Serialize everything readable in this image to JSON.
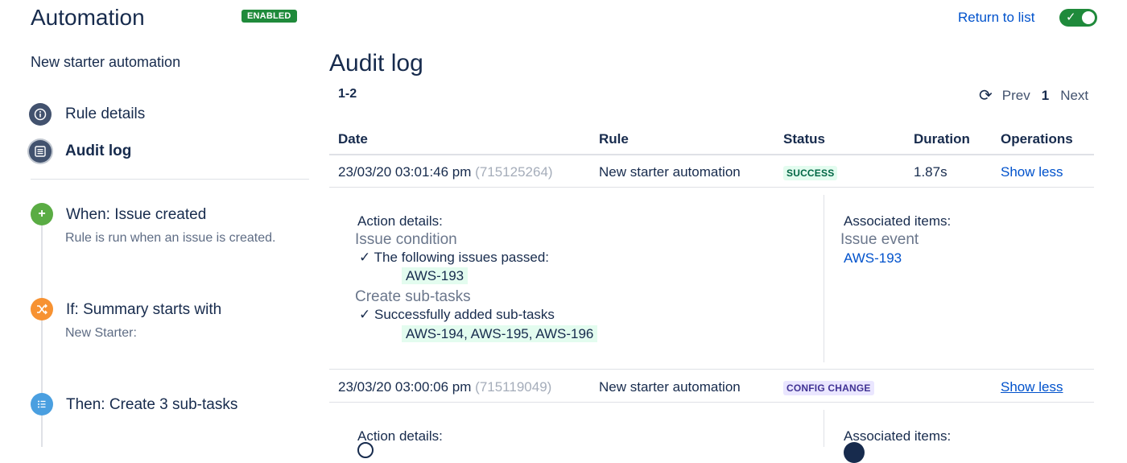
{
  "header": {
    "app_title": "Automation",
    "status_badge": "ENABLED",
    "return_link": "Return to list",
    "toggle_state": "on"
  },
  "sidebar": {
    "rule_name": "New starter automation",
    "nav": [
      {
        "label": "Rule details",
        "icon": "info-icon",
        "active": false
      },
      {
        "label": "Audit log",
        "icon": "list-icon",
        "active": true
      }
    ],
    "steps": [
      {
        "title": "When: Issue created",
        "desc": "Rule is run when an issue is created.",
        "icon": "plus-icon",
        "color": "#5aac44"
      },
      {
        "title": "If: Summary starts with",
        "desc": "New Starter:",
        "icon": "shuffle-icon",
        "color": "#f79232"
      },
      {
        "title": "Then: Create 3 sub-tasks",
        "desc": "",
        "icon": "list-icon",
        "color": "#4a9fe0"
      }
    ]
  },
  "main": {
    "title": "Audit log",
    "range": "1-2",
    "pager": {
      "prev": "Prev",
      "current": "1",
      "next": "Next"
    },
    "columns": [
      "Date",
      "Rule",
      "Status",
      "Duration",
      "Operations"
    ],
    "rows": [
      {
        "date": "23/03/20 03:01:46 pm",
        "id": "(715125264)",
        "rule": "New starter automation",
        "status": "SUCCESS",
        "duration": "1.87s",
        "operation": "Show less",
        "details": {
          "action_header": "Action details:",
          "groups": [
            {
              "name": "Issue condition",
              "line": "The following issues passed:",
              "chip": "AWS-193"
            },
            {
              "name": "Create sub-tasks",
              "line": "Successfully added sub-tasks",
              "chip": "AWS-194, AWS-195, AWS-196"
            }
          ],
          "assoc_header": "Associated items:",
          "assoc_group": "Issue event",
          "assoc_link": "AWS-193"
        }
      },
      {
        "date": "23/03/20 03:00:06 pm",
        "id": "(715119049)",
        "rule": "New starter automation",
        "status": "CONFIG CHANGE",
        "duration": "",
        "operation": "Show less",
        "details": {
          "action_header": "Action details:",
          "assoc_header": "Associated items:"
        }
      }
    ]
  },
  "colors": {
    "enabled_green": "#1f8a3b",
    "link_blue": "#0052cc",
    "success_bg": "#e3fcef",
    "config_bg": "#eae6ff"
  }
}
